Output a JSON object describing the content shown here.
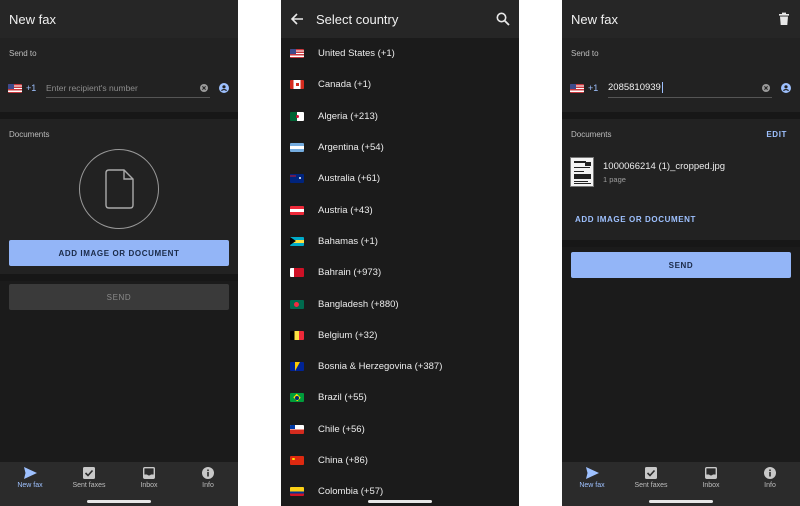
{
  "screen1": {
    "title": "New fax",
    "send_to_label": "Send to",
    "country_code": "+1",
    "number_placeholder": "Enter recipient's number",
    "documents_label": "Documents",
    "add_button": "ADD IMAGE OR DOCUMENT",
    "send_button": "SEND"
  },
  "screen2": {
    "title": "Select country",
    "countries": [
      {
        "name": "United States (+1)",
        "flag": "us"
      },
      {
        "name": "Canada (+1)",
        "flag": "ca"
      },
      {
        "name": "Algeria (+213)",
        "flag": "dz"
      },
      {
        "name": "Argentina (+54)",
        "flag": "ar"
      },
      {
        "name": "Australia (+61)",
        "flag": "au"
      },
      {
        "name": "Austria (+43)",
        "flag": "at"
      },
      {
        "name": "Bahamas (+1)",
        "flag": "bs"
      },
      {
        "name": "Bahrain (+973)",
        "flag": "bh"
      },
      {
        "name": "Bangladesh (+880)",
        "flag": "bd"
      },
      {
        "name": "Belgium (+32)",
        "flag": "be"
      },
      {
        "name": "Bosnia & Herzegovina (+387)",
        "flag": "ba"
      },
      {
        "name": "Brazil (+55)",
        "flag": "br"
      },
      {
        "name": "Chile (+56)",
        "flag": "cl"
      },
      {
        "name": "China (+86)",
        "flag": "cn"
      },
      {
        "name": "Colombia (+57)",
        "flag": "co"
      }
    ]
  },
  "screen3": {
    "title": "New fax",
    "send_to_label": "Send to",
    "country_code": "+1",
    "number_value": "2085810939",
    "documents_label": "Documents",
    "edit_button": "EDIT",
    "file_name": "1000066214 (1)_cropped.jpg",
    "file_pages": "1 page",
    "add_link": "ADD IMAGE OR DOCUMENT",
    "send_button": "SEND"
  },
  "nav": {
    "new_fax": "New fax",
    "sent_faxes": "Sent faxes",
    "inbox": "Inbox",
    "info": "Info"
  },
  "colors": {
    "accent": "#9ec1ff",
    "button_primary": "#93b5f7",
    "background": "#1b1b1b",
    "appbar": "#262626"
  }
}
